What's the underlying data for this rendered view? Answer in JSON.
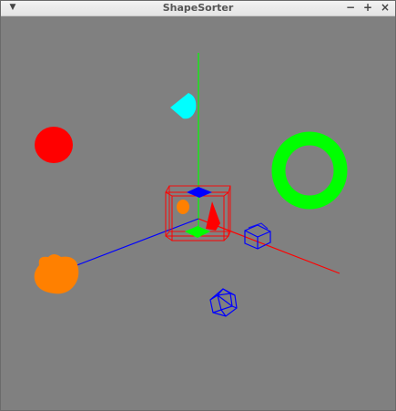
{
  "window": {
    "title": "ShapeSorter",
    "menu_icon": "chevron-down-icon",
    "controls": {
      "minimize_icon": "minimize-icon",
      "maximize_icon": "maximize-icon",
      "close_icon": "close-icon",
      "minimize_glyph": "−",
      "maximize_glyph": "+",
      "close_glyph": "×"
    }
  },
  "scene": {
    "background_color": "#808080",
    "axes": {
      "x_color": "#ff0000",
      "y_color": "#00ff00",
      "z_color": "#0000ff"
    },
    "objects": [
      {
        "name": "cyan-cone",
        "color": "#00ffff"
      },
      {
        "name": "red-sphere",
        "color": "#ff0000"
      },
      {
        "name": "green-torus",
        "color": "#00ff00"
      },
      {
        "name": "orange-blob",
        "color": "#ff8000"
      },
      {
        "name": "red-wireframe-box",
        "color": "#ff0000"
      },
      {
        "name": "blue-wireframe-cube",
        "color": "#0000ff"
      },
      {
        "name": "blue-wireframe-icosahedron",
        "color": "#0000ff"
      }
    ]
  }
}
